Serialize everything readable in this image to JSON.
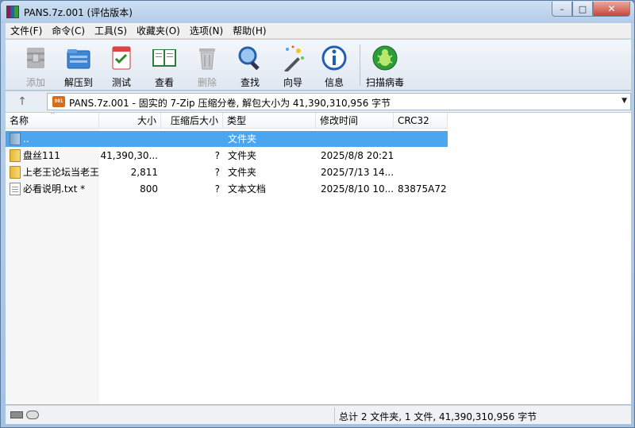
{
  "window": {
    "title": "PANS.7z.001 (评估版本)",
    "controls": {
      "minimize": "–",
      "maximize": "□",
      "close": "✕"
    }
  },
  "menu": [
    "文件(F)",
    "命令(C)",
    "工具(S)",
    "收藏夹(O)",
    "选项(N)",
    "帮助(H)"
  ],
  "toolbar": [
    {
      "label": "添加",
      "icon": "add-archive-icon",
      "enabled": false
    },
    {
      "label": "解压到",
      "icon": "extract-icon",
      "enabled": true
    },
    {
      "label": "测试",
      "icon": "test-icon",
      "enabled": true
    },
    {
      "label": "查看",
      "icon": "view-book-icon",
      "enabled": true
    },
    {
      "label": "删除",
      "icon": "trash-icon",
      "enabled": false
    },
    {
      "label": "查找",
      "icon": "magnifier-icon",
      "enabled": true
    },
    {
      "label": "向导",
      "icon": "wizard-wand-icon",
      "enabled": true
    },
    {
      "label": "信息",
      "icon": "info-icon",
      "enabled": true
    },
    {
      "label": "扫描病毒",
      "icon": "virus-scan-bug-icon",
      "enabled": true
    }
  ],
  "address": {
    "icon_text": "001",
    "path": "PANS.7z.001 - 固实的 7-Zip 压缩分卷, 解包大小为 41,390,310,956 字节"
  },
  "columns": [
    "名称",
    "大小",
    "压缩后大小",
    "类型",
    "修改时间",
    "CRC32"
  ],
  "rows": [
    {
      "name": "..",
      "size": "",
      "packed": "",
      "type": "文件夹",
      "modified": "",
      "crc": "",
      "icon": "folder-up-icon",
      "selected": true
    },
    {
      "name": "盘丝111",
      "size": "41,390,30...",
      "packed": "?",
      "type": "文件夹",
      "modified": "2025/8/8 20:21",
      "crc": "",
      "icon": "folder-icon",
      "selected": false
    },
    {
      "name": "上老王论坛当老王",
      "size": "2,811",
      "packed": "?",
      "type": "文件夹",
      "modified": "2025/7/13 14...",
      "crc": "",
      "icon": "folder-icon",
      "selected": false
    },
    {
      "name": "必看说明.txt *",
      "size": "800",
      "packed": "?",
      "type": "文本文档",
      "modified": "2025/8/10 10...",
      "crc": "83875A72",
      "icon": "text-document-icon",
      "selected": false
    }
  ],
  "status": {
    "summary": "总计 2 文件夹, 1 文件, 41,390,310,956 字节"
  },
  "colors": {
    "selection": "#4ba6ef",
    "title_bar": "#b3cbe8",
    "close_button": "#c7453a"
  }
}
